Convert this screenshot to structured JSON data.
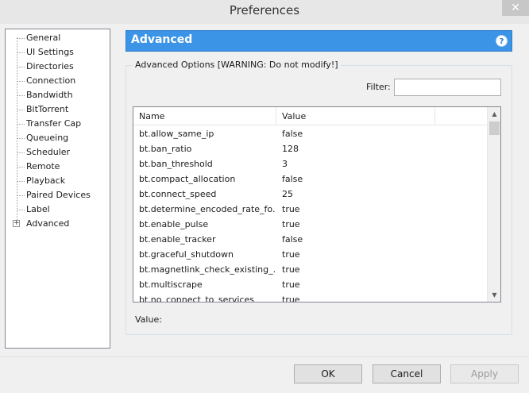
{
  "window": {
    "title": "Preferences",
    "close_glyph": "✕"
  },
  "tree": {
    "items": [
      {
        "label": "General"
      },
      {
        "label": "UI Settings"
      },
      {
        "label": "Directories"
      },
      {
        "label": "Connection"
      },
      {
        "label": "Bandwidth"
      },
      {
        "label": "BitTorrent"
      },
      {
        "label": "Transfer Cap"
      },
      {
        "label": "Queueing"
      },
      {
        "label": "Scheduler"
      },
      {
        "label": "Remote"
      },
      {
        "label": "Playback"
      },
      {
        "label": "Paired Devices"
      },
      {
        "label": "Label"
      },
      {
        "label": "Advanced"
      }
    ],
    "expander_glyph": "+"
  },
  "header": {
    "title": "Advanced",
    "help_glyph": "?"
  },
  "group": {
    "legend": "Advanced Options [WARNING: Do not modify!]"
  },
  "filter": {
    "label": "Filter:",
    "value": ""
  },
  "table": {
    "columns": [
      "Name",
      "Value"
    ],
    "rows": [
      {
        "name": "bt.allow_same_ip",
        "value": "false"
      },
      {
        "name": "bt.ban_ratio",
        "value": "128"
      },
      {
        "name": "bt.ban_threshold",
        "value": "3"
      },
      {
        "name": "bt.compact_allocation",
        "value": "false"
      },
      {
        "name": "bt.connect_speed",
        "value": "25"
      },
      {
        "name": "bt.determine_encoded_rate_fo...",
        "value": "true"
      },
      {
        "name": "bt.enable_pulse",
        "value": "true"
      },
      {
        "name": "bt.enable_tracker",
        "value": "false"
      },
      {
        "name": "bt.graceful_shutdown",
        "value": "true"
      },
      {
        "name": "bt.magnetlink_check_existing_...",
        "value": "true"
      },
      {
        "name": "bt.multiscrape",
        "value": "true"
      },
      {
        "name": "bt.no_connect_to_services",
        "value": "true"
      }
    ]
  },
  "value_field": {
    "label": "Value:"
  },
  "buttons": {
    "ok": "OK",
    "cancel": "Cancel",
    "apply": "Apply"
  },
  "scroll_glyphs": {
    "up": "▲",
    "down": "▼"
  },
  "colors": {
    "accent": "#3c94e6"
  }
}
